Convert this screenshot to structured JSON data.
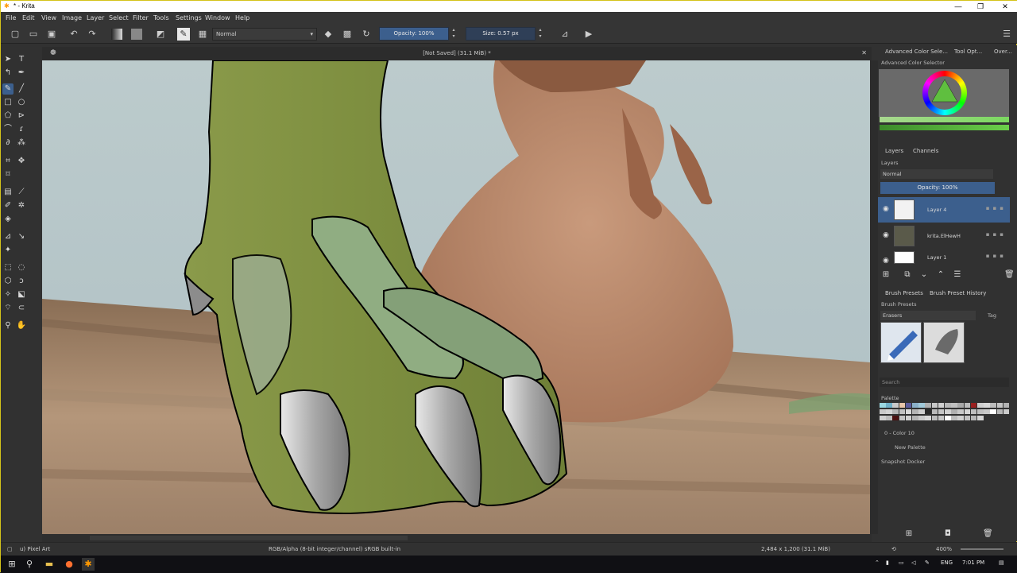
{
  "window": {
    "title": "* - Krita",
    "app_icon": "krita-icon",
    "controls": {
      "minimize": "—",
      "maximize": "❐",
      "close": "✕"
    }
  },
  "menu": [
    "File",
    "Edit",
    "View",
    "Image",
    "Layer",
    "Select",
    "Filter",
    "Tools",
    "Settings",
    "Window",
    "Help"
  ],
  "toolbar": {
    "blend_mode": "Normal",
    "opacity": "Opacity: 100%",
    "size": "Size: 0.57 px"
  },
  "document": {
    "tab_title": "[Not Saved]  (31.1 MiB) *",
    "close": "✕"
  },
  "dockers": {
    "tabs": [
      "Advanced Color Sele...",
      "Tool Opt...",
      "Over..."
    ],
    "color_selector_title": "Advanced Color Selector",
    "layers_tabs": [
      "Layers",
      "Channels"
    ],
    "layers_title": "Layers",
    "layers_blend": "Normal",
    "layers_opacity": "Opacity:  100%",
    "layers": [
      {
        "name": "Layer 4",
        "selected": true
      },
      {
        "name": "krita.ElHewH",
        "selected": false
      },
      {
        "name": "Layer 1",
        "selected": false
      }
    ],
    "brush_tabs": [
      "Brush Presets",
      "Brush Preset History"
    ],
    "brush_presets_title": "Brush Presets",
    "brush_tag": "Erasers",
    "tag_label": "Tag",
    "search_placeholder": "Search",
    "palette_title": "Palette",
    "palette_color": "0 - Color 10",
    "palette_name": "New Palette",
    "snapshot_title": "Snapshot Docker"
  },
  "status": {
    "brush": "u) Pixel Art",
    "color_model": "RGB/Alpha (8-bit integer/channel)  sRGB built-in",
    "dimensions": "2,484 x 1,200 (31.1 MiB)",
    "zoom": "400%"
  },
  "taskbar": {
    "language": "ENG",
    "time": "7:01 PM"
  },
  "colors": {
    "accent": "#3c5f8d",
    "frame": "#d4c31a"
  },
  "palette_swatches": [
    "#9ad7e0",
    "#6fb0c8",
    "#c9c9c9",
    "#e8c6a8",
    "#5c5c9c",
    "#8ab0c8",
    "#a0c8d8",
    "#b0b0b0",
    "#c8c8c8",
    "#d0d0d0",
    "#b8b8b8",
    "#c0c0c0",
    "#a8a8a8",
    "#bcbcbc",
    "#9a2020",
    "#cfcfcf",
    "#d8d8d8",
    "#bdbdbd",
    "#c4c4c4",
    "#b2b2b2",
    "#cacaca",
    "#d4d4d4",
    "#b6b6b6",
    "#c2c2c2",
    "#dadada",
    "#b4b4b4",
    "#cecece",
    "#2a2a2a",
    "#bababa",
    "#c6c6c6",
    "#d2d2d2",
    "#b0b0b0",
    "#c8c8c8",
    "#d6d6d6",
    "#bebebe",
    "#c0c0c0",
    "#c9c9c9",
    "#ffffff",
    "#b8b8b8",
    "#cccccc",
    "#d0d0d0",
    "#bcbcbc",
    "#4a1010",
    "#c4c4c4",
    "#d0d0d0",
    "#b4b4b4",
    "#cacaca",
    "#d8d8d8",
    "#bcbcbc",
    "#c6c6c6",
    "#ffffff",
    "#bbbbbb",
    "#cfcfcf",
    "#c2c2c2",
    "#b6b6b6",
    "#d4d4d4"
  ]
}
